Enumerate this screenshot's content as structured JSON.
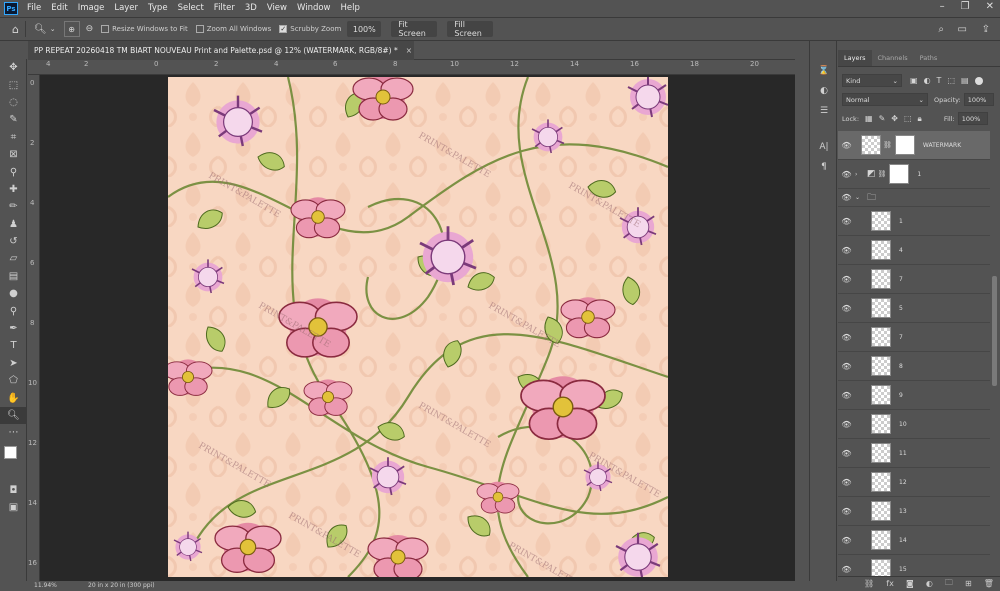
{
  "app": {
    "logo": "Ps"
  },
  "menu": [
    "File",
    "Edit",
    "Image",
    "Layer",
    "Type",
    "Select",
    "Filter",
    "3D",
    "View",
    "Window",
    "Help"
  ],
  "window_controls": [
    "–",
    "❐",
    "✕"
  ],
  "options_bar": {
    "resize_windows": "Resize Windows to Fit",
    "zoom_all_windows": "Zoom All Windows",
    "scrubby_zoom": "Scrubby Zoom",
    "zoom_level": "100%",
    "fit_screen": "Fit Screen",
    "fill_screen": "Fill Screen",
    "scrubby_checked": true
  },
  "document": {
    "tab_title": "PP REPEAT 20260418 TM BIART NOUVEAU Print and Palette.psd @ 12% (WATERMARK, RGB/8#) *",
    "close": "×"
  },
  "ruler": {
    "top": [
      "4",
      "2",
      "0",
      "2",
      "4",
      "6",
      "8",
      "10",
      "12",
      "14",
      "16",
      "18",
      "20",
      "22",
      "24",
      "26",
      "28"
    ],
    "left": [
      "0",
      "2",
      "4",
      "6",
      "8",
      "10",
      "12",
      "14",
      "16",
      "18",
      "20",
      "22",
      "24",
      "26"
    ]
  },
  "status": {
    "zoom": "11.94%",
    "doc_size": "20 in x 20 in (300 ppi)"
  },
  "panel": {
    "tabs": [
      "Layers",
      "Channels",
      "Paths"
    ],
    "kind_label": "Kind",
    "blend_mode": "Normal",
    "opacity_label": "Opacity:",
    "opacity_value": "100%",
    "lock_label": "Lock:",
    "fill_label": "Fill:",
    "fill_value": "100%",
    "layers": [
      {
        "name": "WATERMARK",
        "selected": true
      },
      {
        "name": "1"
      },
      {
        "name": ""
      },
      {
        "name": "1"
      },
      {
        "name": "4"
      },
      {
        "name": "7"
      },
      {
        "name": "5"
      },
      {
        "name": "7"
      },
      {
        "name": "8"
      },
      {
        "name": "9"
      },
      {
        "name": "10"
      },
      {
        "name": "11"
      },
      {
        "name": "12"
      },
      {
        "name": "13"
      },
      {
        "name": "14"
      },
      {
        "name": "15"
      }
    ]
  },
  "colors": {
    "accent": "#31a8ff",
    "canvas_bg": "#f8d7c2",
    "workspace": "#282828"
  }
}
